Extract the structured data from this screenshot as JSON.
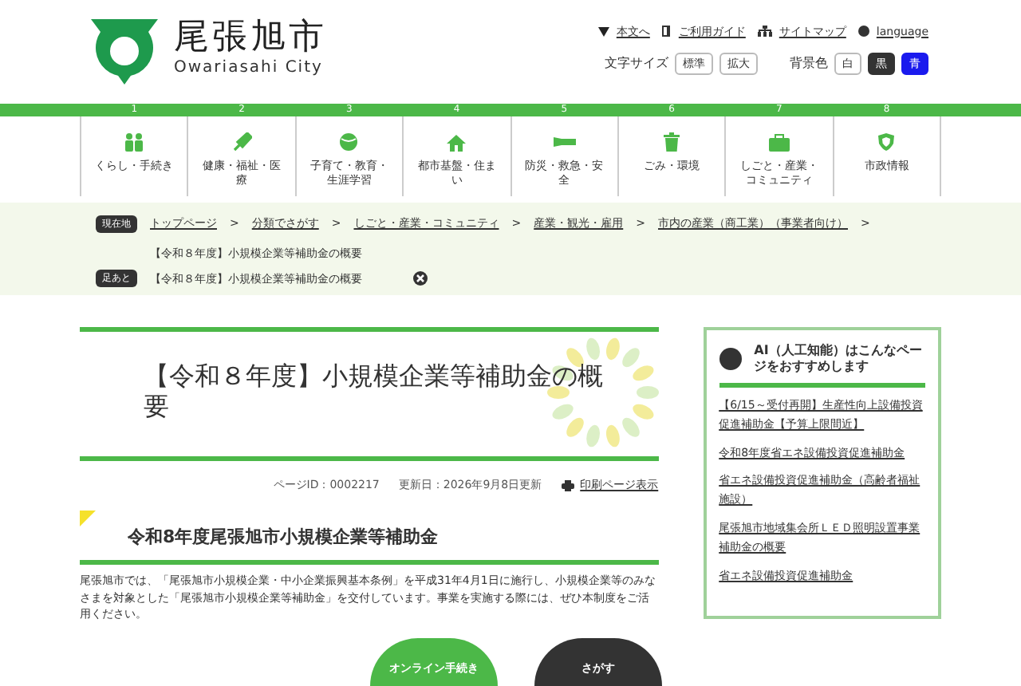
{
  "header": {
    "logo_title": "尾張旭市",
    "logo_subtitle": "Owariasahi City",
    "links": [
      {
        "kind": "skip",
        "label": "本文へ"
      },
      {
        "kind": "guide",
        "label": "ご利用ガイド"
      },
      {
        "kind": "sitemap",
        "label": "サイトマップ"
      },
      {
        "kind": "language",
        "label": "language"
      }
    ],
    "font_size_label": "文字サイズ",
    "font_sizes": [
      {
        "label": "標準"
      },
      {
        "label": "拡大"
      }
    ],
    "bg_label": "背景色",
    "bg_colors": [
      {
        "label": "白",
        "color": "#ffffff"
      },
      {
        "label": "黒",
        "color": "#333333"
      },
      {
        "label": "青",
        "color": "#1a1aee"
      }
    ]
  },
  "nav": [
    {
      "number": "1",
      "label": "くらし・手続き"
    },
    {
      "number": "2",
      "label": "健康・福祉・医療"
    },
    {
      "number": "3",
      "label": "子育て・教育・生涯学習"
    },
    {
      "number": "4",
      "label": "都市基盤・住まい"
    },
    {
      "number": "5",
      "label": "防災・救急・安全"
    },
    {
      "number": "6",
      "label": "ごみ・環境"
    },
    {
      "number": "7",
      "label": "しごと・産業・コミュニティ"
    },
    {
      "number": "8",
      "label": "市政情報"
    }
  ],
  "breadcrumb": {
    "label": "現在地",
    "items": [
      {
        "label": "トップページ",
        "separator": ">"
      },
      {
        "label": "分類でさがす",
        "separator": ">"
      },
      {
        "label": "しごと・産業・コミュニティ",
        "separator": ">"
      },
      {
        "label": "産業・観光・雇用",
        "separator": ">"
      },
      {
        "label": "市内の産業（商工業）（事業者向け）",
        "separator": ">"
      }
    ],
    "current": "【令和８年度】小規模企業等補助金の概要"
  },
  "footprint": {
    "label": "足あと",
    "items": [
      "【令和８年度】小規模企業等補助金の概要"
    ]
  },
  "article": {
    "title": "【令和８年度】小規模企業等補助金の概要",
    "page_id": "ページID：0002217",
    "updated": "更新日：2026年9月8日更新",
    "print_link": "印刷ページ表示",
    "heading": "令和8年度尾張旭市小規模企業等補助金",
    "body": "尾張旭市では、「尾張旭市小規模企業・中小企業振興基本条例」を平成31年4月1日に施行し、小規模企業等のみなさまを対象とした「尾張旭市小規模企業等補助金」を交付しています。事業を実施する際には、ぜひ本制度をご活用ください。"
  },
  "sidebar": {
    "title": "AI（人工知能）はこんなページをおすすめします",
    "links": [
      "【6/15～受付再開】生産性向上設備投資促進補助金【予算上限間近】",
      "令和8年度省エネ設備投資促進補助金",
      "省エネ設備投資促進補助金（高齢者福祉施設）",
      "尾張旭市地域集会所ＬＥＤ照明設置事業補助金の概要",
      "省エネ設備投資促進補助金"
    ]
  },
  "floating": {
    "online": "オンライン手続き",
    "search": "さがす"
  }
}
